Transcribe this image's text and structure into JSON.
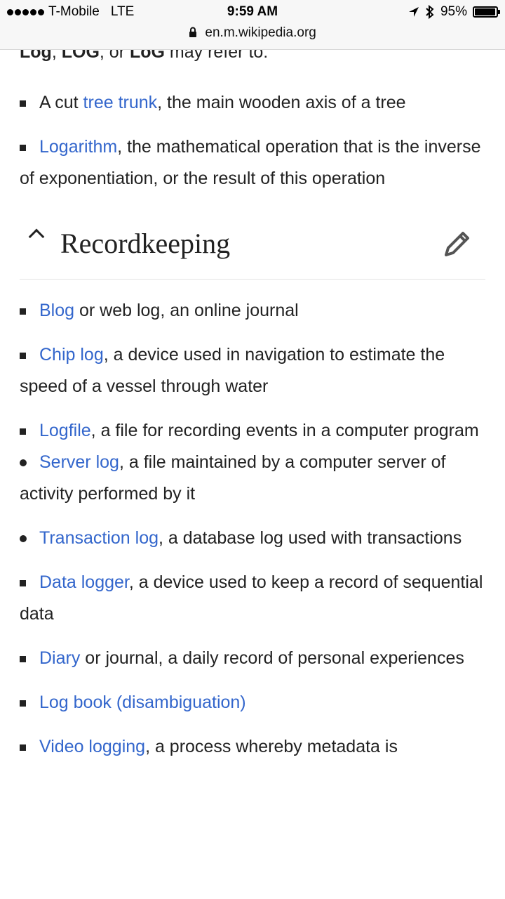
{
  "status": {
    "carrier": "T-Mobile",
    "network": "LTE",
    "time": "9:59 AM",
    "battery": "95%",
    "battery_level": 0.95,
    "url": "en.m.wikipedia.org"
  },
  "article": {
    "intro": {
      "t1": "Log",
      "t2": ", ",
      "t3": "LOG",
      "t4": ", or ",
      "t5": "LoG",
      "t6": " may refer to:"
    },
    "top_items": [
      {
        "pre": "A cut ",
        "link": "tree trunk",
        "post": ", the main wooden axis of a tree"
      },
      {
        "pre": "",
        "link": "Logarithm",
        "post": ", the mathematical operation that is the inverse of exponentiation, or the result of this operation"
      }
    ],
    "section": {
      "title": "Recordkeeping",
      "items": [
        {
          "link": "Blog",
          "post": " or web log, an online journal"
        },
        {
          "link": "Chip log",
          "post": ", a device used in navigation to estimate the speed of a vessel through water"
        },
        {
          "link": "Logfile",
          "post": ", a file for recording events in a computer program",
          "sub": [
            {
              "link": "Server log",
              "post": ", a file maintained by a computer server of activity performed by it"
            },
            {
              "link": "Transaction log",
              "post": ", a database log used with transactions"
            }
          ]
        },
        {
          "link": "Data logger",
          "post": ", a device used to keep a record of sequential data"
        },
        {
          "link": "Diary",
          "post": " or journal, a daily record of personal experiences"
        },
        {
          "link": "Log book (disambiguation)",
          "post": ""
        },
        {
          "link": "Video logging",
          "post": ", a process whereby metadata is"
        }
      ]
    }
  },
  "icons": {
    "collapse": "chevron-up-icon",
    "edit": "pencil-icon",
    "lock": "lock-icon",
    "location": "location-arrow-icon",
    "bluetooth": "bluetooth-icon"
  },
  "colors": {
    "link": "#3366cc",
    "text": "#222222"
  }
}
